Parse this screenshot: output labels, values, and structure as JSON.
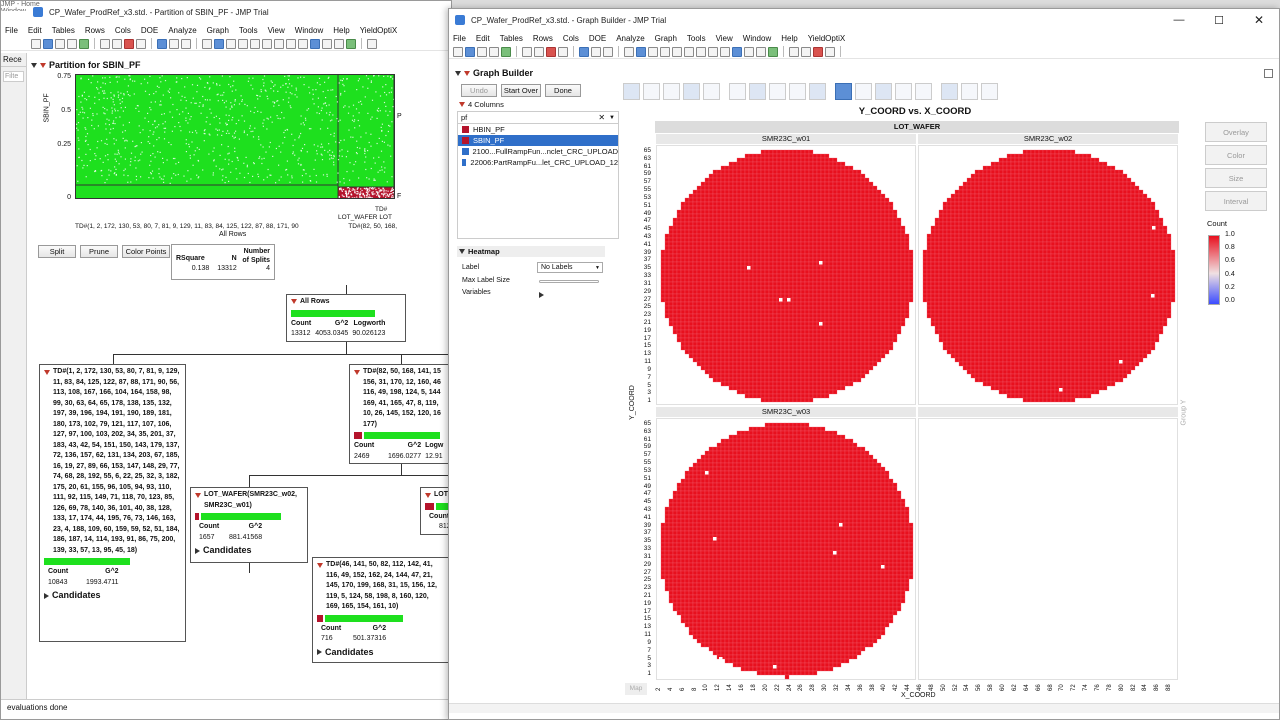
{
  "left_window": {
    "title": "CP_Wafer_ProdRef_x3.std. - Partition of SBIN_PF - JMP Trial",
    "behind_title": "JMP - Home Window",
    "menu": [
      "File",
      "Edit",
      "Tables",
      "Rows",
      "Cols",
      "DOE",
      "Analyze",
      "Graph",
      "Tools",
      "View",
      "Window",
      "Help",
      "YieldOptiX"
    ],
    "side_tab": "Rece",
    "side_filter": "Filte",
    "outline_title": "Partition for SBIN_PF",
    "plot": {
      "ylabel": "SBIN_PF",
      "yticks": [
        "0.75",
        "0.5",
        "0.25",
        "0"
      ],
      "right_labels": [
        "P",
        "F"
      ],
      "split_label": "LOT_WAFER",
      "split_label2": "LOT",
      "td_label": "TD#",
      "x_axis_text": "TD#(1, 2, 172, 130, 53, 80, 7, 81, 9, 129, 11, 83, 84, 125, 122, 87, 88, 171, 90",
      "x_axis_text2": "TD#(82, 50, 168,",
      "x_axis_title": "All Rows"
    },
    "buttons": {
      "split": "Split",
      "prune": "Prune",
      "color_points": "Color Points"
    },
    "summary": {
      "headers": [
        "RSquare",
        "N",
        "Number of Splits"
      ],
      "values": [
        "0.138",
        "13312",
        "4"
      ]
    },
    "all_rows": {
      "title": "All Rows",
      "headers": [
        "Count",
        "G^2",
        "Logworth"
      ],
      "values": [
        "13312",
        "4053.0345",
        "90.026123"
      ]
    },
    "node_left": {
      "text": "TD#(1, 2, 172, 130, 53, 80, 7, 81, 9, 129, 11, 83, 84, 125, 122, 87, 88, 171, 90, 56, 113, 108, 167, 166, 104, 164, 158, 98, 99, 30, 63, 64, 65, 178, 138, 135, 132, 197, 39, 196, 194, 191, 190, 189, 181, 180, 173, 102, 79, 121, 117, 107, 106, 127, 97, 100, 103, 202, 34, 35, 201, 37, 183, 43, 42, 54, 151, 150, 143, 179, 137, 72, 136, 157, 62, 131, 134, 203, 67, 185, 16, 19, 27, 89, 66, 153, 147, 148, 29, 77, 74, 68, 28, 192, 55, 6, 22, 25, 32, 3, 182, 175, 20, 61, 155, 96, 105, 94, 93, 110, 111, 92, 115, 149, 71, 118, 70, 123, 85, 126, 69, 78, 140, 36, 101, 40, 38, 128, 133, 17, 174, 44, 195, 76, 73, 146, 163, 23, 4, 188, 109, 60, 159, 59, 52, 51, 184, 186, 187, 14, 114, 193, 91, 86, 75, 200, 139, 33, 57, 13, 95, 45, 18)",
      "headers": [
        "Count",
        "G^2"
      ],
      "values": [
        "10843",
        "1993.4711"
      ],
      "candidates": "Candidates"
    },
    "node_right": {
      "text": "TD#(82, 50, 168, 141, 15 156, 31, 170, 12, 160, 46 116, 49, 198, 124, 5, 144 169, 41, 165, 47, 8, 119, 10, 26, 145, 152, 120, 16 177)",
      "headers": [
        "Count",
        "G^2",
        "Logw"
      ],
      "values": [
        "2469",
        "1696.0277",
        "12.91"
      ]
    },
    "node_lotwafer": {
      "text": "LOT_WAFER(SMR23C_w02, SMR23C_w01)",
      "headers": [
        "Count",
        "G^2"
      ],
      "values": [
        "1657",
        "881.41568"
      ],
      "candidates": "Candidates"
    },
    "node_lot_right": {
      "text": "LOT_",
      "headers": [
        "Count"
      ],
      "values": [
        "812"
      ]
    },
    "node_bottom": {
      "text": "TD#(46, 141, 50, 82, 112, 142, 41, 116, 49, 152, 162, 24, 144, 47, 21, 145, 170, 199, 168, 31, 15, 156, 12, 119, 5, 124, 58, 198, 8, 160, 120, 169, 165, 154, 161, 10)",
      "headers": [
        "Count",
        "G^2"
      ],
      "values": [
        "716",
        "501.37316"
      ],
      "candidates": "Candidates"
    },
    "status": "evaluations done"
  },
  "right_window": {
    "title": "CP_Wafer_ProdRef_x3.std. - Graph Builder - JMP Trial",
    "menu": [
      "File",
      "Edit",
      "Tables",
      "Rows",
      "Cols",
      "DOE",
      "Analyze",
      "Graph",
      "Tools",
      "View",
      "Window",
      "Help",
      "YieldOptiX"
    ],
    "outline_title": "Graph Builder",
    "buttons": {
      "undo": "Undo",
      "start_over": "Start Over",
      "done": "Done"
    },
    "columns_header": "4 Columns",
    "search_value": "pf",
    "columns": [
      {
        "name": "HBIN_PF",
        "selected": false
      },
      {
        "name": "SBIN_PF",
        "selected": true
      },
      {
        "name": "2100...FullRampFun...nclet_CRC_UPLOAD",
        "selected": false
      },
      {
        "name": "22006:PartRampFu...let_CRC_UPLOAD_12",
        "selected": false
      }
    ],
    "heatmap": {
      "title": "Heatmap",
      "label_label": "Label",
      "label_value": "No Labels",
      "max_label_size": "Max Label Size",
      "variables": "Variables"
    },
    "graph_title": "Y_COORD vs. X_COORD",
    "group_x": "LOT_WAFER",
    "panels": [
      "SMR23C_w01",
      "SMR23C_w02",
      "SMR23C_w03"
    ],
    "y_axis_label": "Y_COORD",
    "x_axis_label": "X_COORD",
    "group_y": "Group Y",
    "map_label": "Map",
    "yticks": [
      "65",
      "63",
      "61",
      "59",
      "57",
      "55",
      "53",
      "51",
      "49",
      "47",
      "45",
      "43",
      "41",
      "39",
      "37",
      "35",
      "33",
      "31",
      "29",
      "27",
      "25",
      "23",
      "21",
      "19",
      "17",
      "15",
      "13",
      "11",
      "9",
      "7",
      "5",
      "3",
      "1"
    ],
    "xticks": [
      "2",
      "4",
      "6",
      "8",
      "10",
      "12",
      "14",
      "16",
      "18",
      "20",
      "22",
      "24",
      "26",
      "28",
      "30",
      "32",
      "34",
      "36",
      "38",
      "40",
      "42",
      "44",
      "46",
      "48",
      "50",
      "52",
      "54",
      "56",
      "58",
      "60",
      "62",
      "64",
      "66",
      "68",
      "70",
      "72",
      "74",
      "76",
      "78",
      "80",
      "82",
      "84",
      "86",
      "88"
    ],
    "side_panels": [
      "Overlay",
      "Color",
      "Size",
      "Interval"
    ],
    "legend": {
      "title": "Count",
      "ticks": [
        "1.0",
        "0.8",
        "0.6",
        "0.4",
        "0.2",
        "0.0"
      ]
    },
    "colors": {
      "fail_red": "#e8101e",
      "pass_green": "#1ee01e",
      "low_blue": "#3b4cff"
    }
  }
}
